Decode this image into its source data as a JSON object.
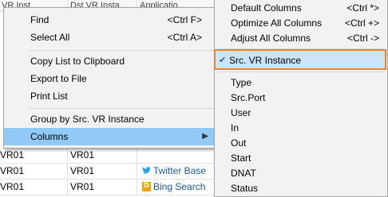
{
  "table": {
    "headers": [
      "VR Inst...",
      "Dst VR Insta...",
      "Applicatio..."
    ],
    "rows": [
      {
        "src": "VR01",
        "dst": "VR01",
        "app": ""
      },
      {
        "src": "VR01",
        "dst": "VR01",
        "app": "Twitter Base",
        "icon": "twitter-icon"
      },
      {
        "src": "VR01",
        "dst": "VR01",
        "app": "Bing Search",
        "icon": "bing-icon"
      }
    ]
  },
  "context_menu": {
    "items": [
      {
        "label": "Find",
        "shortcut": "<Ctrl F>"
      },
      {
        "label": "Select All",
        "shortcut": "<Ctrl A>"
      },
      {
        "label": "Copy List to Clipboard",
        "shortcut": ""
      },
      {
        "label": "Export to File",
        "shortcut": ""
      },
      {
        "label": "Print List",
        "shortcut": ""
      },
      {
        "label": "Group by Src. VR Instance",
        "shortcut": ""
      },
      {
        "label": "Columns",
        "shortcut": "",
        "submenu_arrow": "▶"
      }
    ]
  },
  "columns_submenu": {
    "top_items": [
      {
        "label": "Default Columns",
        "shortcut": "<Ctrl *>"
      },
      {
        "label": "Optimize All Columns",
        "shortcut": "<Ctrl +>"
      },
      {
        "label": "Adjust All Columns",
        "shortcut": "<Ctrl ->"
      }
    ],
    "checked_item": {
      "label": "Src. VR Instance",
      "check": "✔"
    },
    "column_items": [
      "Type",
      "Src.Port",
      "User",
      "In",
      "Out",
      "Start",
      "DNAT",
      "Status"
    ]
  },
  "colors": {
    "highlight": "#91c9f7",
    "checked_border": "#e8872b",
    "menu_bg": "#f2f2f2"
  }
}
